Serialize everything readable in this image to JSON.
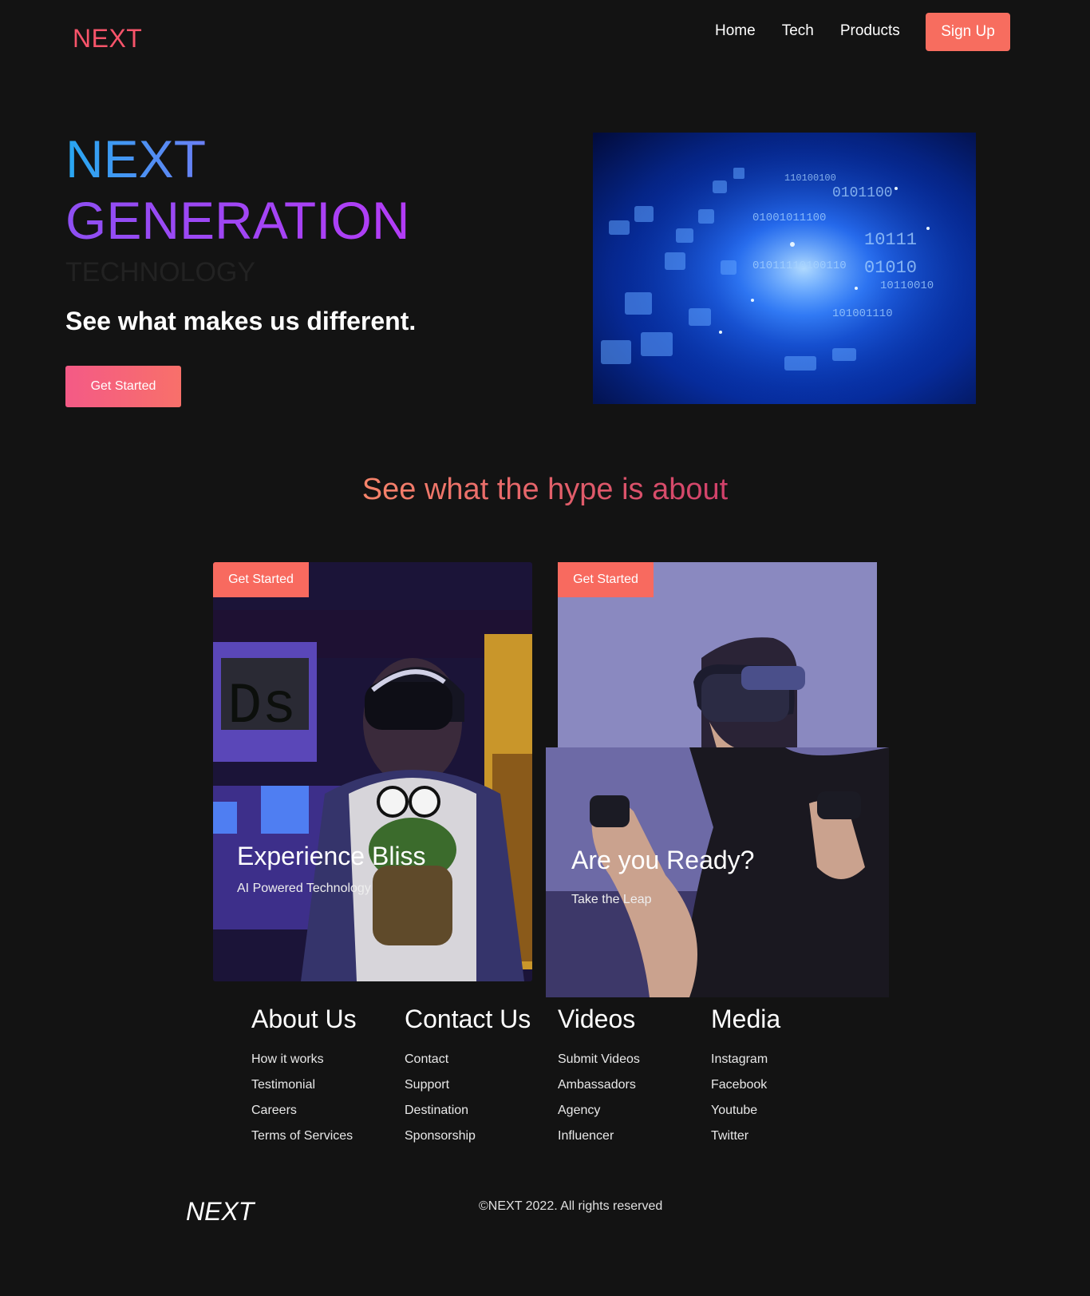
{
  "nav": {
    "logo": "NEXT",
    "links": [
      "Home",
      "Tech",
      "Products"
    ],
    "signup": "Sign Up"
  },
  "hero": {
    "line1": "NEXT",
    "line2": "GENERATION",
    "line3": "TECHNOLOGY",
    "subtitle": "See what makes us different.",
    "cta": "Get Started"
  },
  "hype": {
    "title": "See what the hype is about"
  },
  "cards": [
    {
      "button": "Get Started",
      "title": "Experience Bliss",
      "subtitle": "AI Powered Technology"
    },
    {
      "button": "Get Started",
      "title": "Are you Ready?",
      "subtitle": "Take the Leap"
    }
  ],
  "footer": {
    "columns": [
      {
        "title": "About Us",
        "links": [
          "How it works",
          "Testimonial",
          "Careers",
          "Terms of Services"
        ]
      },
      {
        "title": "Contact Us",
        "links": [
          "Contact",
          "Support",
          "Destination",
          "Sponsorship"
        ]
      },
      {
        "title": "Videos",
        "links": [
          "Submit Videos",
          "Ambassadors",
          "Agency",
          "Influencer"
        ]
      },
      {
        "title": "Media",
        "links": [
          "Instagram",
          "Facebook",
          "Youtube",
          "Twitter"
        ]
      }
    ],
    "logo": "NEXT",
    "copyright": "©NEXT 2022. All rights reserved"
  },
  "colors": {
    "background": "#131313",
    "accent": "#f76d5f",
    "logo": "#f7546a",
    "next_blue": "#27a7f1",
    "generation_purple": "#9b47f4"
  }
}
